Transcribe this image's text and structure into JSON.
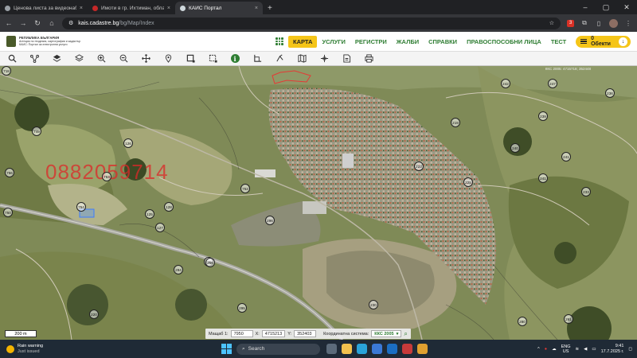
{
  "browser": {
    "tabs": [
      {
        "label": "Ценова листа за видеонаблюдение",
        "favicon_color": "#9aa0a6",
        "active": false
      },
      {
        "label": "Имоти в гр. Ихтиман, област София",
        "favicon_color": "#c62828",
        "active": false
      },
      {
        "label": "КАИС Портал",
        "favicon_color": "#cfd8dc",
        "active": true
      }
    ],
    "new_tab": "+",
    "url_host": "kais.cadastre.bg",
    "url_path": "/bg/Map/Index",
    "extension_badge": "3"
  },
  "site": {
    "logo_line1": "РЕПУБЛИКА БЪЛГАРИЯ",
    "logo_line2": "Агенция по геодезия, картография и кадастър",
    "logo_line3": "КАИС: Портал за електронни услуги",
    "menu": [
      "КАРТА",
      "УСЛУГИ",
      "РЕГИСТРИ",
      "ЖАЛБИ",
      "СПРАВКИ",
      "ПРАВОСПОСОБНИ ЛИЦА",
      "ТЕСТ"
    ],
    "active_menu": "КАРТА",
    "objects_label": "0 Обекти"
  },
  "toolbar": {
    "tools": [
      "search-icon",
      "connect-icon",
      "layers-fill-icon",
      "layers-icon",
      "zoom-in-icon",
      "zoom-out-icon",
      "pan-icon",
      "pin-icon",
      "select-rect-icon",
      "select-area-icon",
      "info-icon",
      "measure-angle-icon",
      "measure-icon",
      "map-icon",
      "crosshair-icon",
      "note-icon",
      "print-icon"
    ],
    "info_glyph": "i"
  },
  "map": {
    "watermark": "0882059714",
    "top_coords": "ККС 2005: 4715718; 352448",
    "scale": "200 m",
    "scale_label": "Мащаб 1:",
    "scale_value": "7950",
    "x_label": "X:",
    "x_value": "4715213",
    "y_label": "Y:",
    "y_value": "352403",
    "system_label": "Координатна система:",
    "system_value": "ККС 2005",
    "parcels": [
      "718",
      "242",
      "125",
      "247",
      "239",
      "241",
      "240",
      "241",
      "233",
      "236",
      "126",
      "752",
      "296",
      "127",
      "128",
      "295",
      "220",
      "294",
      "236",
      "280",
      "261",
      "230",
      "219",
      "225",
      "756",
      "749",
      "753",
      "754",
      "256",
      "223",
      "750"
    ]
  },
  "taskbar": {
    "weather_title": "Rain warning",
    "weather_sub": "Just issued",
    "search_placeholder": "Search",
    "lang_top": "ENG",
    "lang_bottom": "US",
    "time": "9:41",
    "date": "17.7.2025 г."
  }
}
